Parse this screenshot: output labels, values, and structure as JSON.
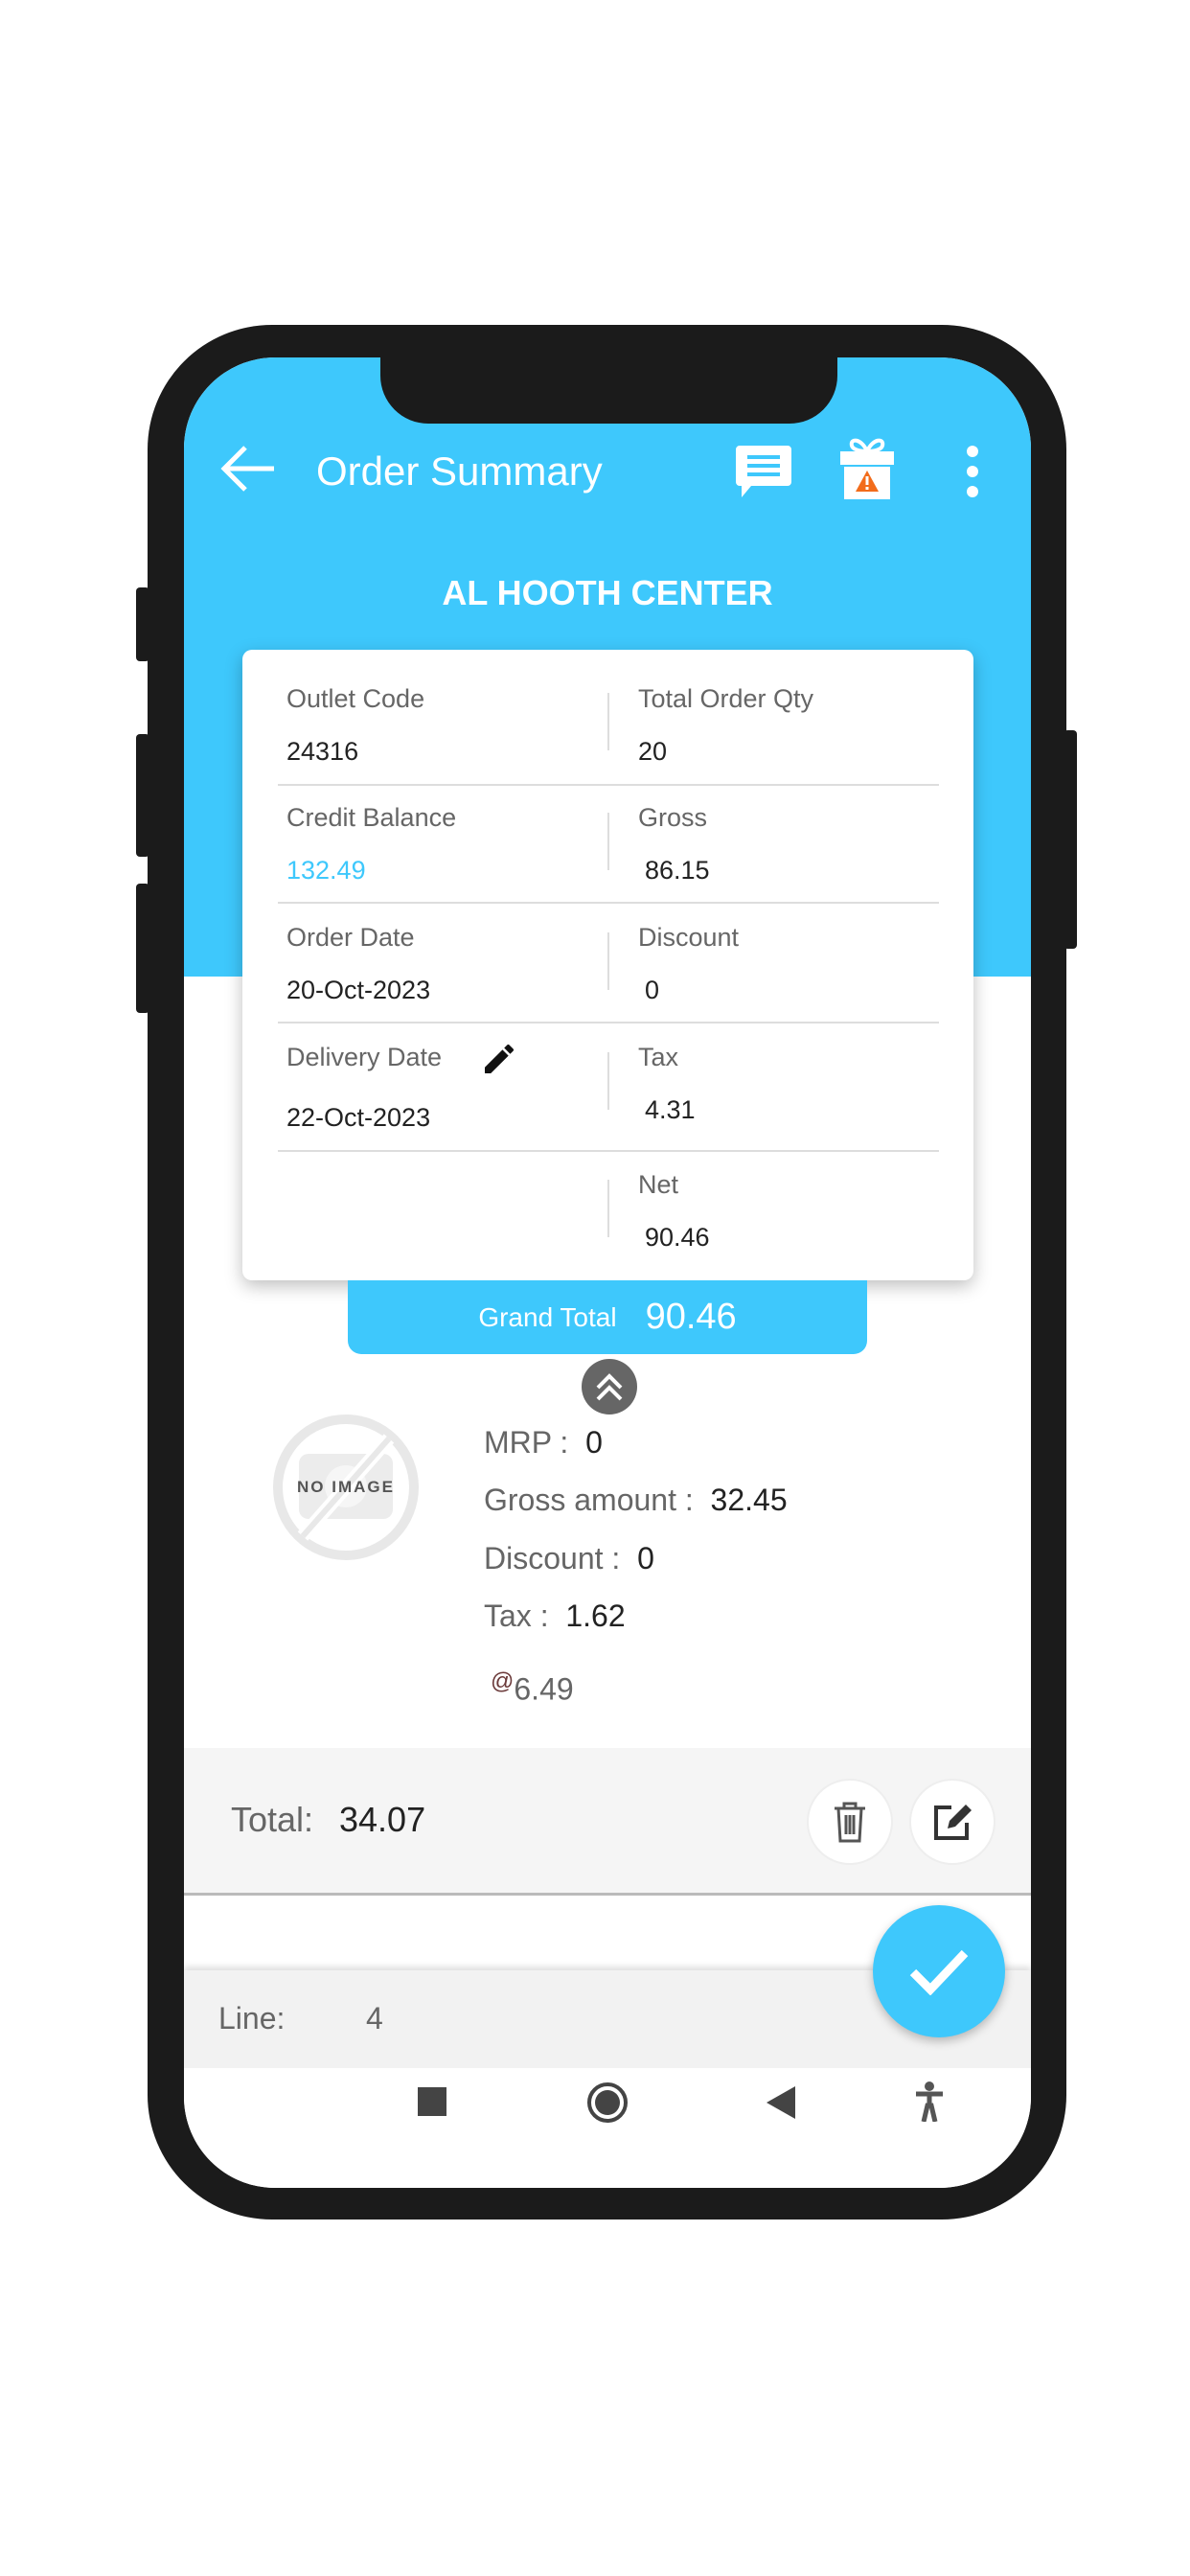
{
  "app_bar": {
    "title": "Order Summary",
    "icons": [
      "back-arrow-icon",
      "chat-icon",
      "gift-alert-icon",
      "more-vert-icon"
    ]
  },
  "store_name": "AL HOOTH CENTER",
  "summary": {
    "outlet_code_label": "Outlet Code",
    "outlet_code": "24316",
    "total_qty_label": "Total Order Qty",
    "total_qty": "20",
    "credit_balance_label": "Credit Balance",
    "credit_balance": "132.49",
    "gross_label": "Gross",
    "gross": "86.15",
    "order_date_label": "Order Date",
    "order_date": "20-Oct-2023",
    "discount_label": "Discount",
    "discount": "0",
    "delivery_date_label": "Delivery Date",
    "delivery_date": "22-Oct-2023",
    "tax_label": "Tax",
    "tax": "4.31",
    "net_label": "Net",
    "net": "90.46"
  },
  "grand_total": {
    "label": "Grand Total",
    "value": "90.46"
  },
  "item": {
    "image_placeholder": "NO IMAGE",
    "mrp_label": "MRP :",
    "mrp": "0",
    "gross_label": "Gross amount :",
    "gross": "32.45",
    "discount_label": "Discount :",
    "discount": "0",
    "tax_label": "Tax :",
    "tax": "1.62",
    "rate_prefix": "@",
    "rate": "6.49",
    "total_label": "Total:",
    "total": "34.07"
  },
  "footer": {
    "line_label": "Line:",
    "line_count": "4"
  },
  "colors": {
    "accent": "#3ec8fc",
    "credit": "#3ec8fc",
    "alert": "#f26c1b"
  }
}
